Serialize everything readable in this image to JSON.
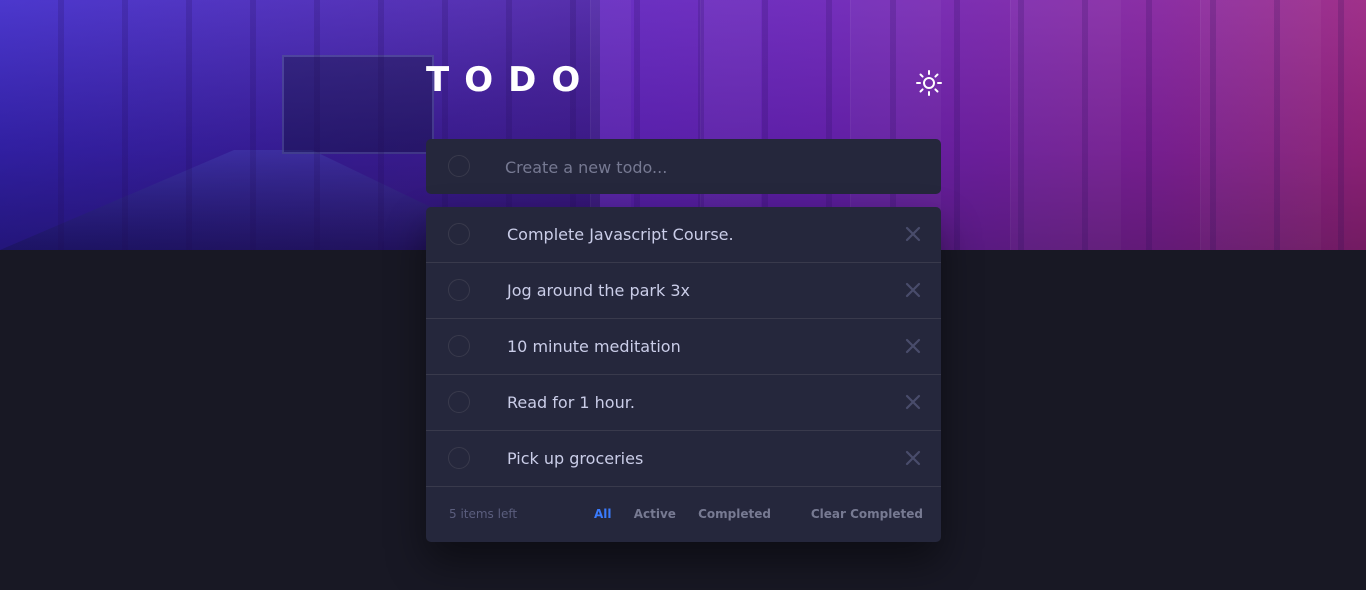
{
  "app": {
    "title": "TODO",
    "theme_toggle_icon": "sun-icon"
  },
  "new_todo": {
    "placeholder": "Create a new todo...",
    "value": ""
  },
  "todos": [
    {
      "text": "Complete Javascript Course.",
      "completed": false
    },
    {
      "text": "Jog around the park 3x",
      "completed": false
    },
    {
      "text": "10 minute meditation",
      "completed": false
    },
    {
      "text": "Read for 1 hour.",
      "completed": false
    },
    {
      "text": "Pick up groceries",
      "completed": false
    }
  ],
  "footer": {
    "items_left": "5 items left",
    "filters": [
      "All",
      "Active",
      "Completed"
    ],
    "active_filter": "All",
    "clear_label": "Clear Completed"
  },
  "colors": {
    "accent": "#3a7bfd",
    "card": "#25273c",
    "background": "#181824",
    "text": "#cacde8",
    "muted": "#777a92"
  }
}
